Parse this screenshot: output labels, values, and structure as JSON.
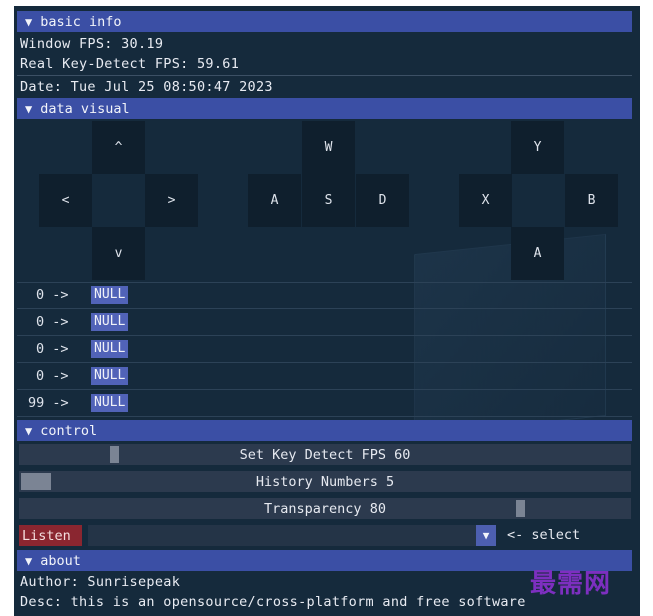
{
  "basic_info": {
    "header": "basic info",
    "window_fps": "Window FPS: 30.19",
    "real_fps": "Real Key-Detect FPS: 59.61",
    "date": "Date: Tue Jul 25 08:50:47 2023"
  },
  "data_visual": {
    "header": "data visual",
    "dpad": {
      "up": "^",
      "left": "<",
      "right": ">",
      "down": "v"
    },
    "wasd": {
      "w": "W",
      "a": "A",
      "s": "S",
      "d": "D"
    },
    "face": {
      "y": "Y",
      "x": "X",
      "b": "B",
      "a": "A"
    },
    "history": [
      {
        "count": "0 ->",
        "key": "NULL"
      },
      {
        "count": "0 ->",
        "key": "NULL"
      },
      {
        "count": "0 ->",
        "key": "NULL"
      },
      {
        "count": "0 ->",
        "key": "NULL"
      },
      {
        "count": "99 ->",
        "key": "NULL"
      }
    ]
  },
  "control": {
    "header": "control",
    "fps_slider": {
      "label": "Set Key Detect FPS 60",
      "value": 60
    },
    "history_slider": {
      "label": "History Numbers 5",
      "value": 5
    },
    "transparency_slider": {
      "label": "Transparency 80",
      "value": 80
    },
    "listen_label": "Listen",
    "select_label": "<- select",
    "combo_arrow": "▼"
  },
  "about": {
    "header": "about",
    "author": "Author: Sunrisepeak",
    "desc": "Desc: this is an opensource/cross-platform and free software"
  },
  "arrow_glyph": "▼",
  "watermark": "最需网"
}
